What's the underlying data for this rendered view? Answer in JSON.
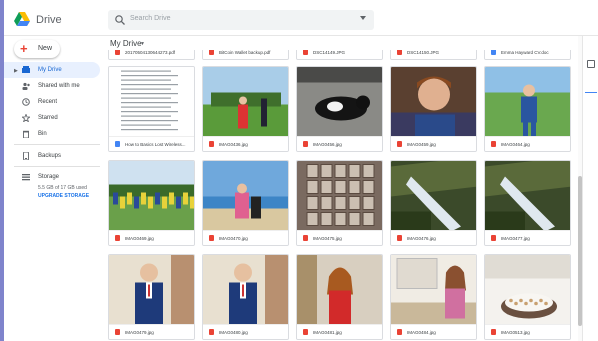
{
  "app": {
    "brand": "Drive"
  },
  "search": {
    "placeholder": "Search Drive"
  },
  "sidebar": {
    "new_label": "New",
    "items": [
      {
        "label": "My Drive",
        "icon": "my-drive-icon",
        "active": true
      },
      {
        "label": "Shared with me",
        "icon": "shared-icon",
        "active": false
      },
      {
        "label": "Recent",
        "icon": "recent-icon",
        "active": false
      },
      {
        "label": "Starred",
        "icon": "star-icon",
        "active": false
      },
      {
        "label": "Bin",
        "icon": "bin-icon",
        "active": false
      },
      {
        "label": "Backups",
        "icon": "backups-icon",
        "active": false
      },
      {
        "label": "Storage",
        "icon": "storage-icon",
        "active": false
      }
    ],
    "storage_used": "5.5 GB of 17 GB used",
    "upgrade_label": "UPGRADE STORAGE"
  },
  "main": {
    "breadcrumb": "My Drive",
    "files": [
      {
        "name": "20170504130644273.pdf",
        "type": "pdf",
        "thumb": "none"
      },
      {
        "name": "BitCoin Wallet backup.pdf",
        "type": "pdf",
        "thumb": "none"
      },
      {
        "name": "DSC14149.JPG",
        "type": "image",
        "thumb": "none"
      },
      {
        "name": "DSC14150.JPG",
        "type": "image",
        "thumb": "none"
      },
      {
        "name": "Emma Hayward CV.doc",
        "type": "doc",
        "thumb": "none"
      },
      {
        "name": "How to Basics Lost Wireless...",
        "type": "doc",
        "thumb": "document"
      },
      {
        "name": "IMAG0436.jpg",
        "type": "image",
        "thumb": "football"
      },
      {
        "name": "IMAG0456.jpg",
        "type": "image",
        "thumb": "cat"
      },
      {
        "name": "IMAG0459.jpg",
        "type": "image",
        "thumb": "boy"
      },
      {
        "name": "IMAG0464.jpg",
        "type": "image",
        "thumb": "field"
      },
      {
        "name": "IMAG0469.jpg",
        "type": "image",
        "thumb": "team"
      },
      {
        "name": "IMAG0470.jpg",
        "type": "image",
        "thumb": "beach"
      },
      {
        "name": "IMAG0475.jpg",
        "type": "image",
        "thumb": "chocolate"
      },
      {
        "name": "IMAG0476.jpg",
        "type": "image",
        "thumb": "stream"
      },
      {
        "name": "IMAG0477.jpg",
        "type": "image",
        "thumb": "stream"
      },
      {
        "name": "IMAG0479.jpg",
        "type": "image",
        "thumb": "uniform"
      },
      {
        "name": "IMAG0480.jpg",
        "type": "image",
        "thumb": "uniform"
      },
      {
        "name": "IMAG0481.jpg",
        "type": "image",
        "thumb": "girl"
      },
      {
        "name": "IMAG0484.jpg",
        "type": "image",
        "thumb": "kitchen"
      },
      {
        "name": "IMAG0513.jpg",
        "type": "image",
        "thumb": "cake"
      }
    ]
  },
  "colors": {
    "accent": "#1a73e8",
    "pdf": "#ea4335",
    "doc": "#4285f4",
    "active_bg": "#e8f0fe"
  }
}
